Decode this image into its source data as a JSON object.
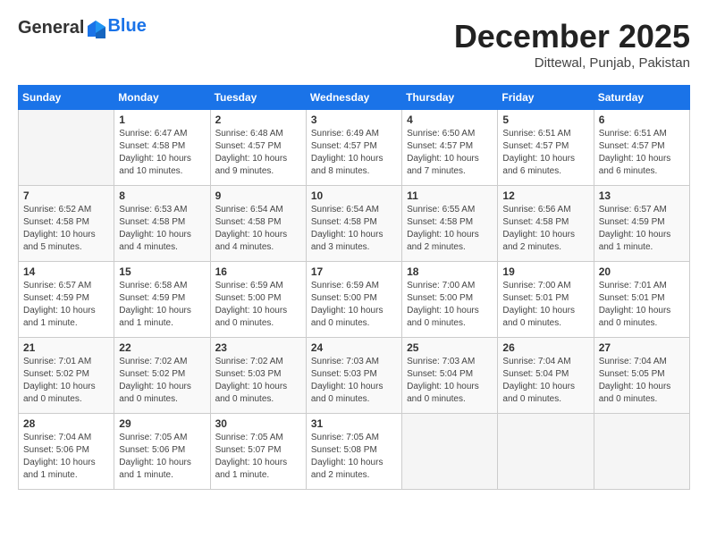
{
  "header": {
    "logo_line1": "General",
    "logo_line2": "Blue",
    "month": "December 2025",
    "location": "Dittewal, Punjab, Pakistan"
  },
  "weekdays": [
    "Sunday",
    "Monday",
    "Tuesday",
    "Wednesday",
    "Thursday",
    "Friday",
    "Saturday"
  ],
  "weeks": [
    [
      {
        "day": "",
        "info": ""
      },
      {
        "day": "1",
        "info": "Sunrise: 6:47 AM\nSunset: 4:58 PM\nDaylight: 10 hours\nand 10 minutes."
      },
      {
        "day": "2",
        "info": "Sunrise: 6:48 AM\nSunset: 4:57 PM\nDaylight: 10 hours\nand 9 minutes."
      },
      {
        "day": "3",
        "info": "Sunrise: 6:49 AM\nSunset: 4:57 PM\nDaylight: 10 hours\nand 8 minutes."
      },
      {
        "day": "4",
        "info": "Sunrise: 6:50 AM\nSunset: 4:57 PM\nDaylight: 10 hours\nand 7 minutes."
      },
      {
        "day": "5",
        "info": "Sunrise: 6:51 AM\nSunset: 4:57 PM\nDaylight: 10 hours\nand 6 minutes."
      },
      {
        "day": "6",
        "info": "Sunrise: 6:51 AM\nSunset: 4:57 PM\nDaylight: 10 hours\nand 6 minutes."
      }
    ],
    [
      {
        "day": "7",
        "info": "Sunrise: 6:52 AM\nSunset: 4:58 PM\nDaylight: 10 hours\nand 5 minutes."
      },
      {
        "day": "8",
        "info": "Sunrise: 6:53 AM\nSunset: 4:58 PM\nDaylight: 10 hours\nand 4 minutes."
      },
      {
        "day": "9",
        "info": "Sunrise: 6:54 AM\nSunset: 4:58 PM\nDaylight: 10 hours\nand 4 minutes."
      },
      {
        "day": "10",
        "info": "Sunrise: 6:54 AM\nSunset: 4:58 PM\nDaylight: 10 hours\nand 3 minutes."
      },
      {
        "day": "11",
        "info": "Sunrise: 6:55 AM\nSunset: 4:58 PM\nDaylight: 10 hours\nand 2 minutes."
      },
      {
        "day": "12",
        "info": "Sunrise: 6:56 AM\nSunset: 4:58 PM\nDaylight: 10 hours\nand 2 minutes."
      },
      {
        "day": "13",
        "info": "Sunrise: 6:57 AM\nSunset: 4:59 PM\nDaylight: 10 hours\nand 1 minute."
      }
    ],
    [
      {
        "day": "14",
        "info": "Sunrise: 6:57 AM\nSunset: 4:59 PM\nDaylight: 10 hours\nand 1 minute."
      },
      {
        "day": "15",
        "info": "Sunrise: 6:58 AM\nSunset: 4:59 PM\nDaylight: 10 hours\nand 1 minute."
      },
      {
        "day": "16",
        "info": "Sunrise: 6:59 AM\nSunset: 5:00 PM\nDaylight: 10 hours\nand 0 minutes."
      },
      {
        "day": "17",
        "info": "Sunrise: 6:59 AM\nSunset: 5:00 PM\nDaylight: 10 hours\nand 0 minutes."
      },
      {
        "day": "18",
        "info": "Sunrise: 7:00 AM\nSunset: 5:00 PM\nDaylight: 10 hours\nand 0 minutes."
      },
      {
        "day": "19",
        "info": "Sunrise: 7:00 AM\nSunset: 5:01 PM\nDaylight: 10 hours\nand 0 minutes."
      },
      {
        "day": "20",
        "info": "Sunrise: 7:01 AM\nSunset: 5:01 PM\nDaylight: 10 hours\nand 0 minutes."
      }
    ],
    [
      {
        "day": "21",
        "info": "Sunrise: 7:01 AM\nSunset: 5:02 PM\nDaylight: 10 hours\nand 0 minutes."
      },
      {
        "day": "22",
        "info": "Sunrise: 7:02 AM\nSunset: 5:02 PM\nDaylight: 10 hours\nand 0 minutes."
      },
      {
        "day": "23",
        "info": "Sunrise: 7:02 AM\nSunset: 5:03 PM\nDaylight: 10 hours\nand 0 minutes."
      },
      {
        "day": "24",
        "info": "Sunrise: 7:03 AM\nSunset: 5:03 PM\nDaylight: 10 hours\nand 0 minutes."
      },
      {
        "day": "25",
        "info": "Sunrise: 7:03 AM\nSunset: 5:04 PM\nDaylight: 10 hours\nand 0 minutes."
      },
      {
        "day": "26",
        "info": "Sunrise: 7:04 AM\nSunset: 5:04 PM\nDaylight: 10 hours\nand 0 minutes."
      },
      {
        "day": "27",
        "info": "Sunrise: 7:04 AM\nSunset: 5:05 PM\nDaylight: 10 hours\nand 0 minutes."
      }
    ],
    [
      {
        "day": "28",
        "info": "Sunrise: 7:04 AM\nSunset: 5:06 PM\nDaylight: 10 hours\nand 1 minute."
      },
      {
        "day": "29",
        "info": "Sunrise: 7:05 AM\nSunset: 5:06 PM\nDaylight: 10 hours\nand 1 minute."
      },
      {
        "day": "30",
        "info": "Sunrise: 7:05 AM\nSunset: 5:07 PM\nDaylight: 10 hours\nand 1 minute."
      },
      {
        "day": "31",
        "info": "Sunrise: 7:05 AM\nSunset: 5:08 PM\nDaylight: 10 hours\nand 2 minutes."
      },
      {
        "day": "",
        "info": ""
      },
      {
        "day": "",
        "info": ""
      },
      {
        "day": "",
        "info": ""
      }
    ]
  ]
}
